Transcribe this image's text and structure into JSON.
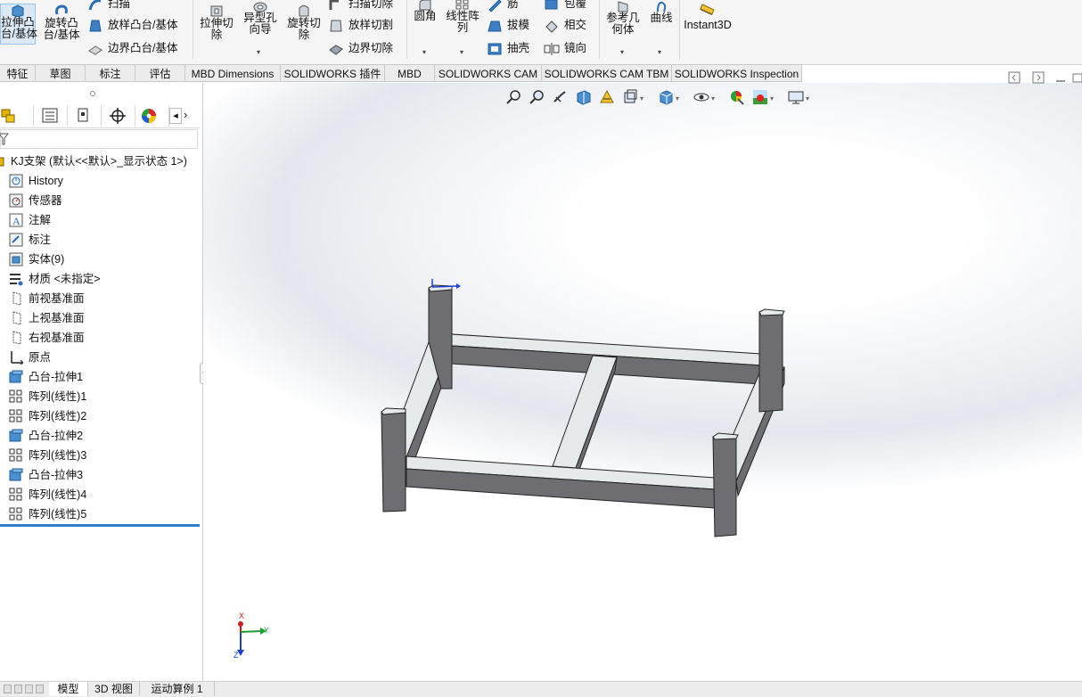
{
  "ribbon": {
    "extrude_boss": "拉伸凸\n台/基体",
    "revolve_boss": "旋转凸\n台/基体",
    "sweep": "扫描",
    "loft_boss": "放样凸台/基体",
    "boundary_boss": "边界凸台/基体",
    "extrude_cut": "拉伸切\n除",
    "hole_wizard": "异型孔\n向导",
    "revolve_cut": "旋转切\n除",
    "sweep_cut": "扫描切除",
    "loft_cut": "放样切割",
    "boundary_cut": "边界切除",
    "fillet": "圆角",
    "linear_pattern": "线性阵\n列",
    "rib": "筋",
    "draft": "拔模",
    "shell": "抽壳",
    "wrap": "包覆",
    "intersect": "相交",
    "mirror": "镜向",
    "ref_geometry": "参考几\n何体",
    "curves": "曲线",
    "instant3d": "Instant3D"
  },
  "tabs": [
    "特征",
    "草图",
    "标注",
    "评估",
    "MBD Dimensions",
    "SOLIDWORKS 插件",
    "MBD",
    "SOLIDWORKS CAM",
    "SOLIDWORKS CAM TBM",
    "SOLIDWORKS Inspection"
  ],
  "tree": {
    "root": "KJ支架 (默认<<默认>_显示状态 1>)",
    "items": [
      "History",
      "传感器",
      "注解",
      "标注",
      "实体(9)",
      "材质 <未指定>",
      "前视基准面",
      "上视基准面",
      "右视基准面",
      "原点",
      "凸台-拉伸1",
      "阵列(线性)1",
      "阵列(线性)2",
      "凸台-拉伸2",
      "阵列(线性)3",
      "凸台-拉伸3",
      "阵列(线性)4",
      "阵列(线性)5"
    ]
  },
  "bottom_tabs": [
    "模型",
    "3D 视图",
    "运动算例 1"
  ],
  "triad": {
    "x": "X",
    "y": "Y",
    "z": "Z"
  },
  "colors": {
    "accent": "#2e7fd2",
    "metal_side": "#6e6e72",
    "metal_top": "#e6e9ea"
  }
}
